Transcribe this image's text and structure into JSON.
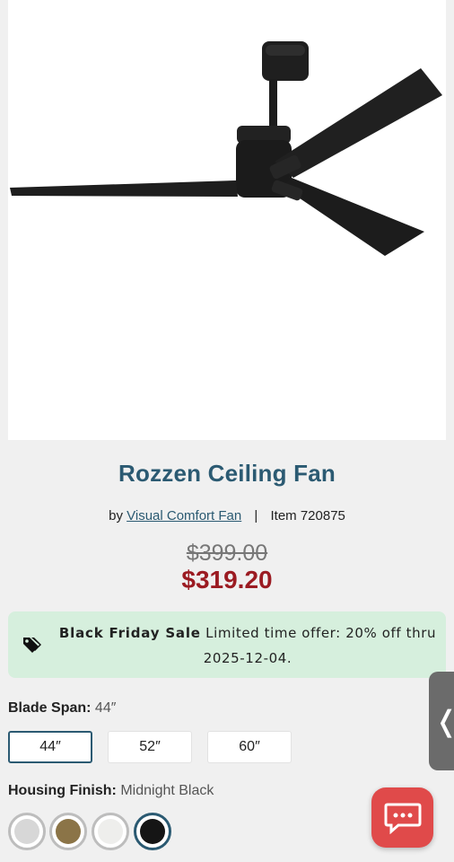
{
  "product": {
    "title": "Rozzen Ceiling Fan",
    "by_prefix": "by",
    "brand": "Visual Comfort Fan",
    "separator": "|",
    "item": "Item 720875",
    "original_price": "$399.00",
    "sale_price": "$319.20"
  },
  "promo": {
    "title": "Black Friday Sale",
    "message": "Limited time offer: 20% off thru 2025-12-04.",
    "icon": "tags-icon",
    "background": "#d6efdd"
  },
  "blade_span": {
    "label": "Blade Span:",
    "selected": "44″",
    "options": [
      "44″",
      "52″",
      "60″"
    ]
  },
  "housing_finish": {
    "label": "Housing Finish:",
    "selected": "Midnight Black",
    "swatches": [
      {
        "name": "silver",
        "color": "#d7d7d7"
      },
      {
        "name": "brass",
        "color": "#8b7447"
      },
      {
        "name": "white",
        "color": "#eeeeec"
      },
      {
        "name": "black",
        "color": "#151515"
      }
    ]
  },
  "colors": {
    "accent": "#2b5a72",
    "sale": "#9b1b22",
    "chat": "#e04a4a"
  },
  "side_tab": {
    "icon": "chevron-left-icon",
    "glyph": "❬"
  },
  "chat": {
    "icon": "chat-icon"
  }
}
